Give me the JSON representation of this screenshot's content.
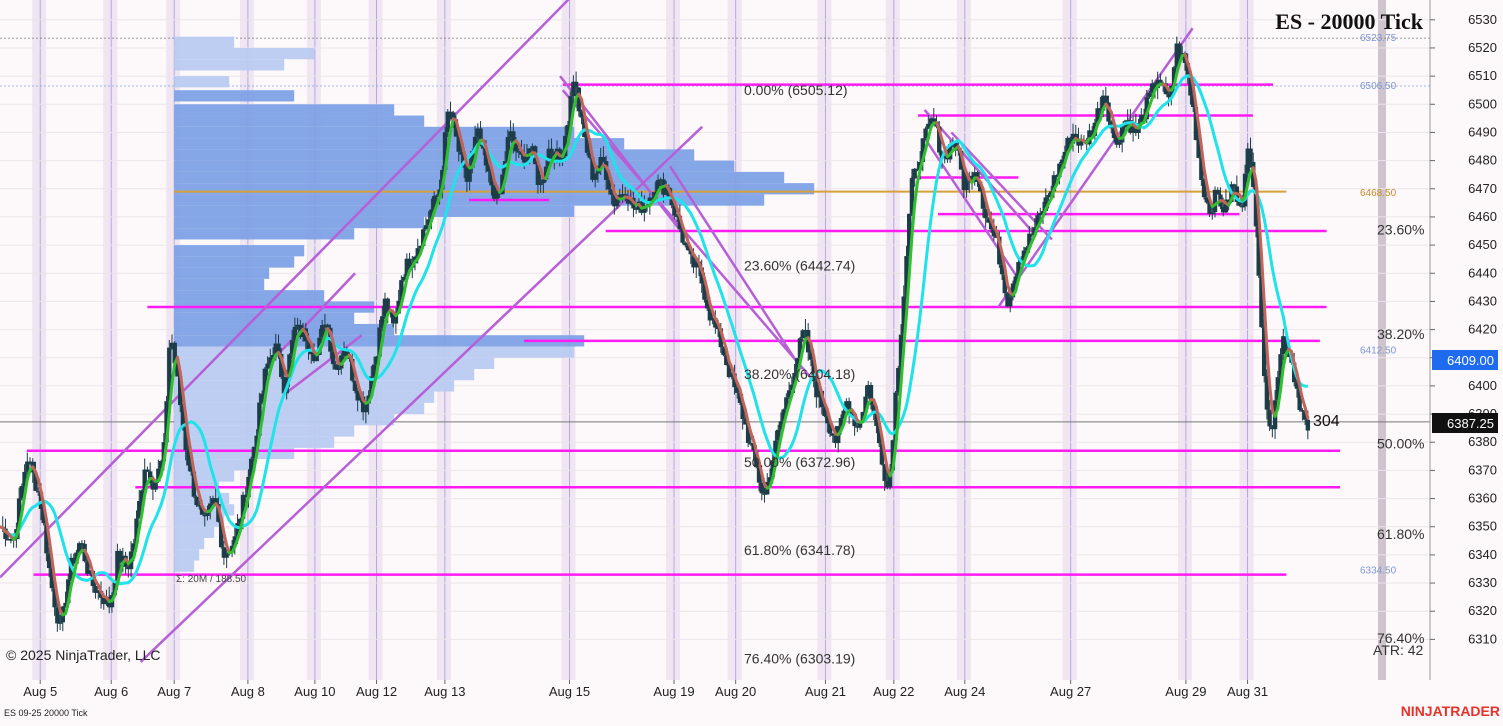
{
  "chart_data": {
    "type": "candlestick",
    "title": "ES - 20000 Tick",
    "instrument_label": "ES 09-25 20000 Tick",
    "copyright": "© 2025 NinjaTrader, LLC",
    "brand": "NINJATRADER",
    "ylim": [
      6302,
      6535
    ],
    "y_ticks": [
      6310,
      6320,
      6330,
      6340,
      6350,
      6360,
      6370,
      6380,
      6390,
      6400,
      6410,
      6420,
      6430,
      6440,
      6450,
      6460,
      6470,
      6480,
      6490,
      6500,
      6510,
      6520,
      6530
    ],
    "x_range": [
      0,
      1000
    ],
    "x_labels": [
      {
        "label": "Aug 5",
        "x": 30
      },
      {
        "label": "Aug 6",
        "x": 83
      },
      {
        "label": "Aug 7",
        "x": 130
      },
      {
        "label": "Aug 8",
        "x": 185
      },
      {
        "label": "Aug 10",
        "x": 235
      },
      {
        "label": "Aug 12",
        "x": 281
      },
      {
        "label": "Aug 13",
        "x": 332
      },
      {
        "label": "Aug 15",
        "x": 425
      },
      {
        "label": "Aug 19",
        "x": 503
      },
      {
        "label": "Aug 20",
        "x": 549
      },
      {
        "label": "Aug 21",
        "x": 616
      },
      {
        "label": "Aug 22",
        "x": 667
      },
      {
        "label": "Aug 24",
        "x": 720
      },
      {
        "label": "Aug 27",
        "x": 799
      },
      {
        "label": "Aug 29",
        "x": 885
      },
      {
        "label": "Aug 31",
        "x": 931
      }
    ],
    "price_path": [
      [
        0,
        6350
      ],
      [
        10,
        6345
      ],
      [
        20,
        6375
      ],
      [
        30,
        6360
      ],
      [
        38,
        6330
      ],
      [
        45,
        6313
      ],
      [
        52,
        6335
      ],
      [
        60,
        6345
      ],
      [
        68,
        6330
      ],
      [
        75,
        6326
      ],
      [
        82,
        6322
      ],
      [
        88,
        6340
      ],
      [
        95,
        6335
      ],
      [
        100,
        6345
      ],
      [
        108,
        6372
      ],
      [
        115,
        6365
      ],
      [
        122,
        6375
      ],
      [
        127,
        6420
      ],
      [
        132,
        6403
      ],
      [
        138,
        6380
      ],
      [
        145,
        6362
      ],
      [
        152,
        6350
      ],
      [
        160,
        6360
      ],
      [
        167,
        6340
      ],
      [
        175,
        6345
      ],
      [
        182,
        6360
      ],
      [
        190,
        6380
      ],
      [
        198,
        6405
      ],
      [
        205,
        6415
      ],
      [
        212,
        6400
      ],
      [
        220,
        6420
      ],
      [
        228,
        6418
      ],
      [
        236,
        6410
      ],
      [
        243,
        6425
      ],
      [
        250,
        6405
      ],
      [
        257,
        6415
      ],
      [
        265,
        6400
      ],
      [
        272,
        6392
      ],
      [
        280,
        6410
      ],
      [
        287,
        6430
      ],
      [
        294,
        6420
      ],
      [
        300,
        6440
      ],
      [
        310,
        6448
      ],
      [
        320,
        6460
      ],
      [
        328,
        6470
      ],
      [
        335,
        6500
      ],
      [
        340,
        6488
      ],
      [
        348,
        6472
      ],
      [
        356,
        6490
      ],
      [
        364,
        6475
      ],
      [
        372,
        6465
      ],
      [
        380,
        6490
      ],
      [
        388,
        6480
      ],
      [
        396,
        6485
      ],
      [
        403,
        6470
      ],
      [
        410,
        6485
      ],
      [
        418,
        6480
      ],
      [
        424,
        6495
      ],
      [
        428,
        6510
      ],
      [
        435,
        6490
      ],
      [
        442,
        6475
      ],
      [
        450,
        6480
      ],
      [
        458,
        6465
      ],
      [
        466,
        6470
      ],
      [
        474,
        6462
      ],
      [
        482,
        6465
      ],
      [
        490,
        6472
      ],
      [
        498,
        6470
      ],
      [
        506,
        6458
      ],
      [
        514,
        6445
      ],
      [
        522,
        6440
      ],
      [
        530,
        6425
      ],
      [
        538,
        6415
      ],
      [
        546,
        6402
      ],
      [
        554,
        6390
      ],
      [
        562,
        6375
      ],
      [
        570,
        6360
      ],
      [
        577,
        6375
      ],
      [
        584,
        6390
      ],
      [
        592,
        6405
      ],
      [
        600,
        6420
      ],
      [
        608,
        6400
      ],
      [
        616,
        6390
      ],
      [
        624,
        6380
      ],
      [
        632,
        6395
      ],
      [
        640,
        6385
      ],
      [
        648,
        6400
      ],
      [
        656,
        6380
      ],
      [
        663,
        6362
      ],
      [
        668,
        6395
      ],
      [
        674,
        6430
      ],
      [
        680,
        6470
      ],
      [
        688,
        6485
      ],
      [
        696,
        6495
      ],
      [
        704,
        6480
      ],
      [
        712,
        6488
      ],
      [
        720,
        6470
      ],
      [
        728,
        6478
      ],
      [
        736,
        6460
      ],
      [
        744,
        6450
      ],
      [
        752,
        6430
      ],
      [
        760,
        6445
      ],
      [
        768,
        6452
      ],
      [
        776,
        6460
      ],
      [
        784,
        6470
      ],
      [
        792,
        6480
      ],
      [
        800,
        6490
      ],
      [
        808,
        6485
      ],
      [
        816,
        6492
      ],
      [
        824,
        6505
      ],
      [
        832,
        6485
      ],
      [
        840,
        6495
      ],
      [
        848,
        6490
      ],
      [
        856,
        6500
      ],
      [
        864,
        6510
      ],
      [
        872,
        6500
      ],
      [
        878,
        6520
      ],
      [
        884,
        6515
      ],
      [
        890,
        6500
      ],
      [
        896,
        6475
      ],
      [
        902,
        6462
      ],
      [
        908,
        6468
      ],
      [
        914,
        6462
      ],
      [
        920,
        6472
      ],
      [
        926,
        6460
      ],
      [
        931,
        6488
      ],
      [
        935,
        6470
      ],
      [
        939,
        6445
      ],
      [
        944,
        6400
      ],
      [
        948,
        6380
      ],
      [
        952,
        6400
      ],
      [
        958,
        6418
      ],
      [
        964,
        6408
      ],
      [
        970,
        6394
      ],
      [
        976,
        6383
      ]
    ],
    "fib_levels": [
      {
        "label": "0.00% (6505.12)",
        "price": 6505.12
      },
      {
        "label": "23.60% (6442.74)",
        "price": 6442.74
      },
      {
        "label": "38.20% (6404.18)",
        "price": 6404.18
      },
      {
        "label": "50.00% (6372.96)",
        "price": 6372.96
      },
      {
        "label": "61.80% (6341.78)",
        "price": 6341.78
      },
      {
        "label": "76.40% (6303.19)",
        "price": 6303.19
      }
    ],
    "fib_right_labels": [
      {
        "label": "23.60%",
        "price": 6455.5
      },
      {
        "label": "38.20%",
        "price": 6418.5
      },
      {
        "label": "50.00%",
        "price": 6379.5
      },
      {
        "label": "61.80%",
        "price": 6347.5
      },
      {
        "label": "76.40%",
        "price": 6310.5
      }
    ],
    "horizontal_lines": [
      {
        "price": 6507,
        "x1": 420,
        "x2": 950
      },
      {
        "price": 6496,
        "x1": 685,
        "x2": 935
      },
      {
        "price": 6474,
        "x1": 680,
        "x2": 760
      },
      {
        "price": 6466,
        "x1": 350,
        "x2": 410
      },
      {
        "price": 6461,
        "x1": 700,
        "x2": 925
      },
      {
        "price": 6455,
        "x1": 452,
        "x2": 990
      },
      {
        "price": 6428,
        "x1": 110,
        "x2": 990
      },
      {
        "price": 6416,
        "x1": 391,
        "x2": 985
      },
      {
        "price": 6377,
        "x1": 20,
        "x2": 1000
      },
      {
        "price": 6364,
        "x1": 101,
        "x2": 1000
      },
      {
        "price": 6333,
        "x1": 25,
        "x2": 960
      }
    ],
    "trend_lines": [
      {
        "x1": 0,
        "y1": 6332,
        "x2": 430,
        "y2": 6540
      },
      {
        "x1": 105,
        "y1": 6302,
        "x2": 524,
        "y2": 6492
      },
      {
        "x1": 205,
        "y1": 6410,
        "x2": 265,
        "y2": 6440
      },
      {
        "x1": 215,
        "y1": 6398,
        "x2": 270,
        "y2": 6418
      },
      {
        "x1": 418,
        "y1": 6510,
        "x2": 508,
        "y2": 6455
      },
      {
        "x1": 420,
        "y1": 6505,
        "x2": 605,
        "y2": 6403
      },
      {
        "x1": 500,
        "y1": 6478,
        "x2": 598,
        "y2": 6406
      },
      {
        "x1": 690,
        "y1": 6498,
        "x2": 770,
        "y2": 6455
      },
      {
        "x1": 710,
        "y1": 6490,
        "x2": 785,
        "y2": 6452
      },
      {
        "x1": 690,
        "y1": 6488,
        "x2": 760,
        "y2": 6438
      },
      {
        "x1": 745,
        "y1": 6428,
        "x2": 890,
        "y2": 6527
      }
    ],
    "volume_profile": {
      "total_label": "Σ: 20M / 188.50",
      "poc_price": 6469,
      "poc_color": "#d6a03a",
      "color_dark": "#7ea1e6",
      "color_light": "#b9cbf1",
      "rows": [
        [
          6522,
          60
        ],
        [
          6518,
          140
        ],
        [
          6514,
          110
        ],
        [
          6508,
          55
        ],
        [
          6503,
          120
        ],
        [
          6498,
          220
        ],
        [
          6494,
          250
        ],
        [
          6490,
          400
        ],
        [
          6486,
          450
        ],
        [
          6482,
          520
        ],
        [
          6478,
          560
        ],
        [
          6474,
          610
        ],
        [
          6470,
          640
        ],
        [
          6466,
          590
        ],
        [
          6462,
          400
        ],
        [
          6458,
          250
        ],
        [
          6454,
          180
        ],
        [
          6448,
          130
        ],
        [
          6444,
          120
        ],
        [
          6440,
          95
        ],
        [
          6436,
          90
        ],
        [
          6432,
          150
        ],
        [
          6428,
          200
        ],
        [
          6424,
          180
        ],
        [
          6420,
          220
        ],
        [
          6416,
          410
        ],
        [
          6412,
          400
        ],
        [
          6408,
          320
        ],
        [
          6404,
          300
        ],
        [
          6400,
          280
        ],
        [
          6396,
          260
        ],
        [
          6392,
          250
        ],
        [
          6388,
          220
        ],
        [
          6384,
          180
        ],
        [
          6380,
          160
        ],
        [
          6376,
          120
        ],
        [
          6372,
          80
        ],
        [
          6368,
          60
        ],
        [
          6364,
          45
        ],
        [
          6360,
          55
        ],
        [
          6356,
          60
        ],
        [
          6352,
          50
        ],
        [
          6348,
          40
        ],
        [
          6344,
          30
        ],
        [
          6340,
          25
        ],
        [
          6336,
          20
        ]
      ]
    },
    "right_markers": [
      {
        "label": "6523.75",
        "price": 6523.5
      },
      {
        "label": "6506.50",
        "price": 6506.5
      },
      {
        "label": "6468.50",
        "price": 6468.5
      },
      {
        "label": "6412.50",
        "price": 6412.5
      },
      {
        "label": "6334.50",
        "price": 6334.5
      }
    ],
    "last_price": "6387.25",
    "marker_price": "6409.00",
    "tick_counter": "304",
    "atr_label": "ATR: 42",
    "colors": {
      "candle_body": "#1c3d48",
      "fast_ma_up": "#2fbf2f",
      "fast_ma_down": "#c1645a",
      "slow_ma": "#1fe3ea",
      "level_line": "#ff1bf2",
      "trend_line": "#b65fd6",
      "session_band": "#e9dfee",
      "session_line": "#8b7fe0"
    }
  }
}
